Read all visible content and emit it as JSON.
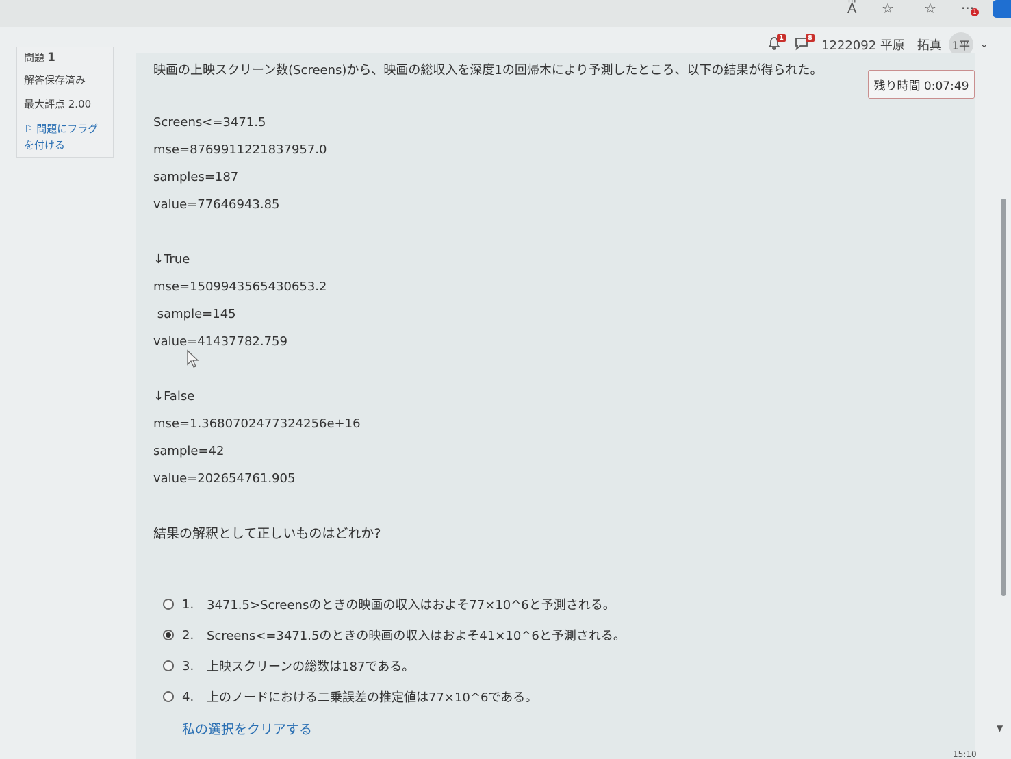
{
  "browser": {
    "icons": [
      "read-aloud-icon",
      "favorite-star-icon",
      "favorites-list-icon",
      "more-icon"
    ],
    "more_badge": "1"
  },
  "userbar": {
    "notifications_count": "1",
    "messages_count": "8",
    "user_name": "1222092 平原　拓真",
    "avatar_text": "1平"
  },
  "question_info": {
    "label": "問題",
    "number": "1",
    "status": "解答保存済み",
    "max_score": "最大評点 2.00",
    "flag_label": "問題にフラグを付ける"
  },
  "timer": "残り時間 0:07:49",
  "question": {
    "text": "映画の上映スクリーン数(Screens)から、映画の総収入を深度1の回帰木により予測したところ、以下の結果が得られた。",
    "tree_lines": [
      "Screens<=3471.5",
      "mse=8769911221837957.0",
      "samples=187",
      "value=77646943.85",
      "↓True",
      "mse=1509943565430653.2",
      " sample=145",
      "value=41437782.759",
      "↓False",
      "mse=1.3680702477324256e+16",
      "sample=42",
      "value=202654761.905"
    ],
    "prompt": "結果の解釈として正しいものはどれか?"
  },
  "options": [
    {
      "num": "1.",
      "text": "3471.5>Screensのときの映画の収入はおよそ77×10^6と予測される。",
      "selected": false
    },
    {
      "num": "2.",
      "text": "Screens<=3471.5のときの映画の収入はおよそ41×10^6と予測される。",
      "selected": true
    },
    {
      "num": "3.",
      "text": "上映スクリーンの総数は187である。",
      "selected": false
    },
    {
      "num": "4.",
      "text": "上のノードにおける二乗誤差の推定値は77×10^6である。",
      "selected": false
    }
  ],
  "clear_choice": "私の選択をクリアする",
  "clock": "15:10"
}
